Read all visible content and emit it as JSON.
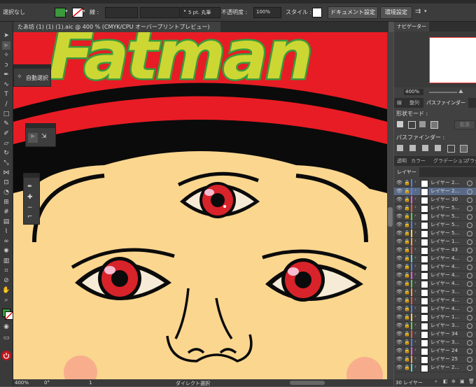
{
  "control_bar": {
    "selection_state": "選択なし",
    "stroke_label": "線 :",
    "stroke_profile": "5 pt. 丸筆",
    "opacity_label": "不透明度 :",
    "opacity_value": "100%",
    "style_label": "スタイル :",
    "document_setup_button": "ドキュメント設定",
    "preferences_button": "環境設定"
  },
  "document_tab": {
    "title": "たあ坊 (1) (1) (1).aic @ 400 % (CMYK/CPU オーバープリントプレビュー)"
  },
  "floating_panels": {
    "magic_wand_label": "自動選択"
  },
  "artwork": {
    "title_text": "Fatman",
    "colors": {
      "band_red": "#e81c24",
      "band_black": "#0b0b0b",
      "skin": "#fad68f",
      "title_yellow": "#cdd733",
      "title_green": "#3a9a3c",
      "iris_red": "#d8232a",
      "cheek": "#f7a78c"
    }
  },
  "navigator": {
    "tab_label": "ナビゲーター",
    "zoom_value": "400%"
  },
  "pathfinder": {
    "tabs": [
      "線",
      "整列",
      "パスファインダー"
    ],
    "shape_modes_label": "形状モード :",
    "expand_button": "拡張",
    "pathfinders_label": "パスファインダー :"
  },
  "color_tabs": [
    "透明",
    "カラー",
    "グラデーション",
    "ブラシ"
  ],
  "layers": {
    "tab_label": "レイヤー",
    "rows": [
      {
        "name": "レイヤー 2...",
        "color": "#4f7fff",
        "selected": false
      },
      {
        "name": "レイヤー 2...",
        "color": "#4f7fff",
        "selected": true
      },
      {
        "name": "レイヤー 30",
        "color": "#ff4ff0",
        "selected": false
      },
      {
        "name": "レイヤー 5...",
        "color": "#ff4f4f",
        "selected": false
      },
      {
        "name": "レイヤー 5...",
        "color": "#4fd64f",
        "selected": false
      },
      {
        "name": "レイヤー 5...",
        "color": "#4f7fff",
        "selected": false
      },
      {
        "name": "レイヤー 5...",
        "color": "#ffd24f",
        "selected": false
      },
      {
        "name": "レイヤー 1...",
        "color": "#ff9f4f",
        "selected": false
      },
      {
        "name": "レイヤー 43",
        "color": "#ff4f4f",
        "selected": false
      },
      {
        "name": "レイヤー 4...",
        "color": "#4fd6d6",
        "selected": false
      },
      {
        "name": "レイヤー 4...",
        "color": "#4f7fff",
        "selected": false
      },
      {
        "name": "レイヤー 4...",
        "color": "#ff4ff0",
        "selected": false
      },
      {
        "name": "レイヤー 4...",
        "color": "#4fd64f",
        "selected": false
      },
      {
        "name": "レイヤー 3...",
        "color": "#ff9f4f",
        "selected": false
      },
      {
        "name": "レイヤー 4...",
        "color": "#ff4f4f",
        "selected": false
      },
      {
        "name": "レイヤー 4...",
        "color": "#4f7fff",
        "selected": false
      },
      {
        "name": "レイヤー 1...",
        "color": "#ffd24f",
        "selected": false
      },
      {
        "name": "レイヤー 3...",
        "color": "#4fd64f",
        "selected": false
      },
      {
        "name": "レイヤー 34",
        "color": "#ff4f4f",
        "selected": false
      },
      {
        "name": "レイヤー 3...",
        "color": "#4f7fff",
        "selected": false
      },
      {
        "name": "レイヤー 24",
        "color": "#ff4ff0",
        "selected": false
      },
      {
        "name": "レイヤー 25",
        "color": "#ff9f4f",
        "selected": false
      },
      {
        "name": "レイヤー 2...",
        "color": "#4fd6d6",
        "selected": false
      }
    ],
    "count_label": "30 レイヤー"
  },
  "status_bar": {
    "zoom": "400%",
    "rotation": "0°",
    "artboard_number": "1",
    "current_tool": "ダイレクト選択"
  }
}
